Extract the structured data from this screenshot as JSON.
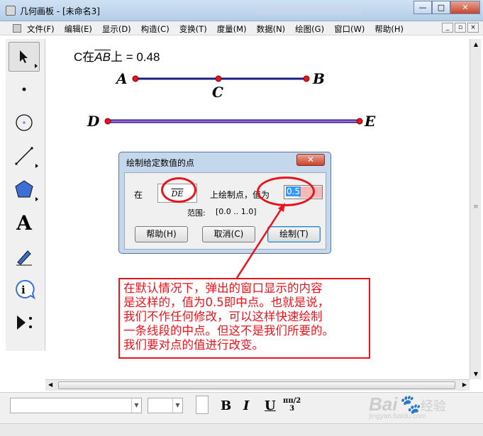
{
  "window": {
    "title": "几何画板 - [未命名3]",
    "minimize": "—",
    "maximize": "□",
    "close": "✕"
  },
  "menubar": {
    "items": [
      "文件(F)",
      "编辑(E)",
      "显示(D)",
      "构造(C)",
      "变换(T)",
      "度量(M)",
      "数据(N)",
      "绘图(G)",
      "窗口(W)",
      "帮助(H)"
    ],
    "mdi": [
      "_",
      "▫",
      "×"
    ]
  },
  "toolbox": {
    "tools": [
      {
        "icon": "arrow-select-icon",
        "glyph": "➤"
      },
      {
        "icon": "point-icon",
        "glyph": "•"
      },
      {
        "icon": "compass-icon",
        "glyph": "⊙"
      },
      {
        "icon": "line-icon",
        "glyph": "╱"
      },
      {
        "icon": "polygon-icon",
        "glyph": "⬟"
      },
      {
        "icon": "text-icon",
        "glyph": "A"
      },
      {
        "icon": "marker-icon",
        "glyph": "✎"
      },
      {
        "icon": "info-icon",
        "glyph": "ⓘ"
      },
      {
        "icon": "custom-tool-icon",
        "glyph": "▶⋮"
      }
    ]
  },
  "canvas": {
    "measurement": {
      "prefix": "C在",
      "segment": "AB",
      "suffix": "上 = 0.48"
    },
    "points": {
      "A": "A",
      "B": "B",
      "C": "C",
      "D": "D",
      "E": "E"
    }
  },
  "dialog": {
    "title": "绘制给定数值的点",
    "close": "✕",
    "label_on": "在",
    "segment": "DE",
    "label_plot": "上绘制点，值为",
    "value": "0.5",
    "range_label": "范围:",
    "range_value": "[0.0 .. 1.0]",
    "buttons": {
      "help": "帮助(H)",
      "cancel": "取消(C)",
      "plot": "绘制(T)"
    }
  },
  "annotation": {
    "lines": [
      "在默认情况下，弹出的窗口显示的内容",
      "是这样的，值为0.5即中点。也就是说，",
      "我们不作任何修改，可以这样快速绘制",
      "一条线段的中点。但这不是我们所要的。",
      "我们要对点的值进行改变。"
    ],
    "color": "#e8141c"
  },
  "formatbar": {
    "bold": "B",
    "italic": "I",
    "underline": "U",
    "fraction": "ππ/2 / 3"
  },
  "watermark": {
    "brand": "Bai",
    "suffix": "经验",
    "domain": "jingyan.baidu.com"
  },
  "colors": {
    "segment_ab": "#1c1c8a",
    "segment_de": "#7a1fa2",
    "point": "#e8141c"
  }
}
